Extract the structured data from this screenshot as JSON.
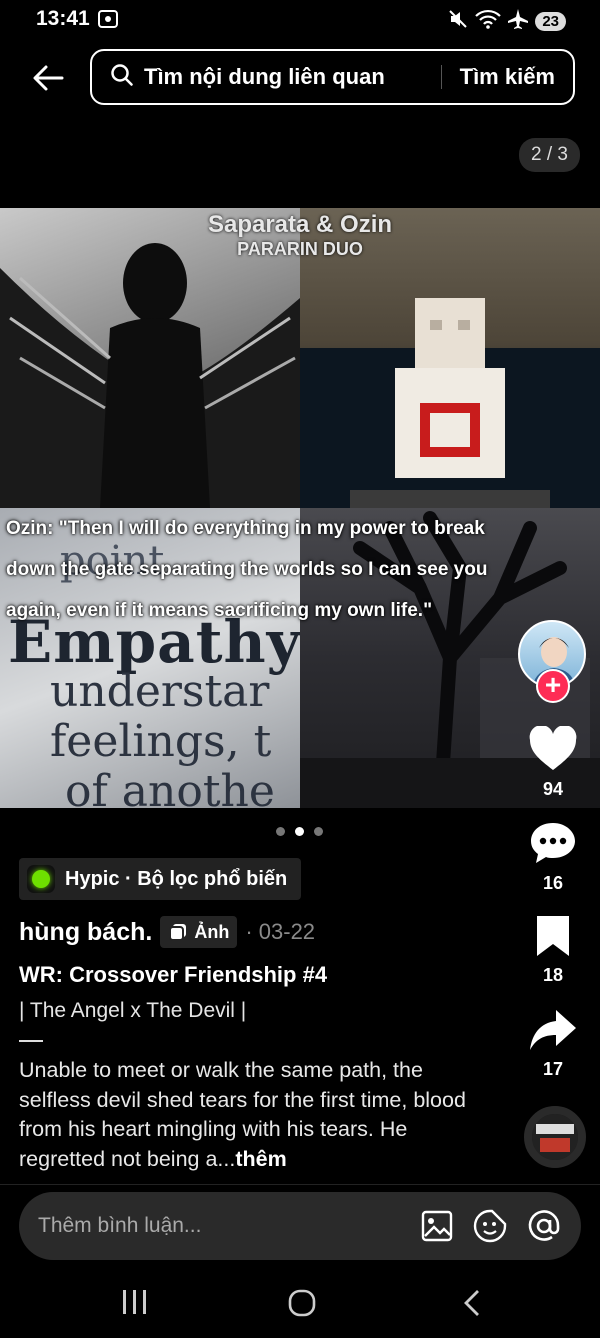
{
  "status_bar": {
    "time": "13:41",
    "battery": "23"
  },
  "search": {
    "placeholder": "Tìm nội dung liên quan",
    "button": "Tìm kiếm"
  },
  "page_counter": "2 / 3",
  "collage": {
    "title": "Saparata & Ozin",
    "subtitle": "PARARIN DUO",
    "quote_lines": [
      "Ozin: \"Then I will do everything in my power to break",
      "down the gate separating the worlds so I can see you",
      "again, even if it means sacrificing my own life.\""
    ],
    "page_words": [
      "Empathy",
      "understar",
      "feelings, t",
      "of anothe"
    ]
  },
  "carousel": {
    "total": 3,
    "active": 1
  },
  "rail": {
    "likes": "94",
    "comments": "16",
    "saves": "18",
    "shares": "17"
  },
  "filter": {
    "label": "Hypic · Bộ lọc phổ biến",
    "accent": "#6ee000"
  },
  "post": {
    "author": "hùng bách.",
    "type_badge": "Ảnh",
    "date": "· 03-22",
    "title": "WR: Crossover Friendship #4",
    "subtitle": "| The Angel x The Devil |",
    "description": "Unable to meet or walk the same path, the selfless devil shed tears for the first time, blood from his heart mingling with his tears. He regretted not being a...",
    "more": "thêm"
  },
  "comment_bar": {
    "placeholder": "Thêm bình luận..."
  },
  "colors": {
    "follow": "#fe2c55",
    "background": "#000000"
  }
}
